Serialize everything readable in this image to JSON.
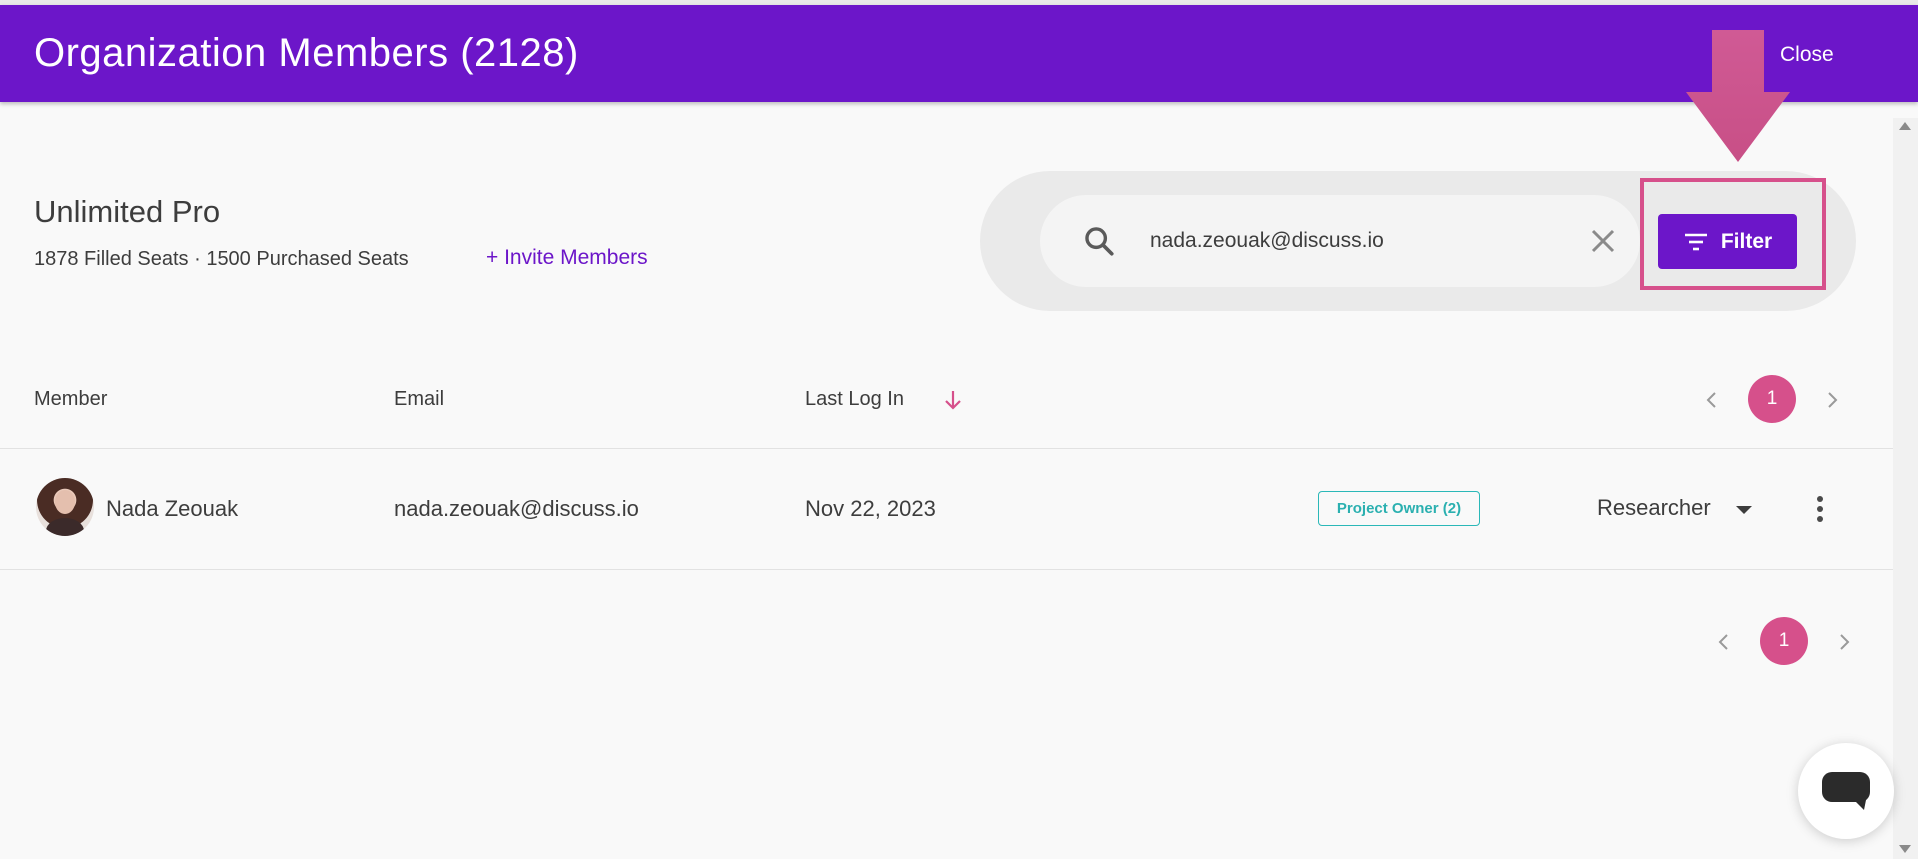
{
  "header": {
    "title": "Organization Members (2128)",
    "close_label": "Close",
    "color": "#6c16c9"
  },
  "plan": {
    "name": "Unlimited Pro",
    "seats": "1878 Filled Seats · 1500 Purchased Seats",
    "invite_label": "+ Invite Members"
  },
  "search": {
    "value": "nada.zeouak@discuss.io",
    "icon": "search-icon",
    "clear_icon": "close-icon"
  },
  "filter": {
    "label": "Filter",
    "icon": "filter-icon"
  },
  "table": {
    "columns": [
      "Member",
      "Email",
      "Last Log In"
    ],
    "sort": {
      "column": "Last Log In",
      "direction": "descending",
      "icon": "arrow-down-icon"
    },
    "rows": [
      {
        "name": "Nada Zeouak",
        "email": "nada.zeouak@discuss.io",
        "last_login": "Nov 22, 2023",
        "badge": "Project Owner (2)",
        "role": "Researcher"
      }
    ]
  },
  "pagination": {
    "current_page": "1"
  },
  "colors": {
    "accent": "#6c16c9",
    "pink": "#d6508b",
    "badge_teal": "#2bb8b8"
  }
}
